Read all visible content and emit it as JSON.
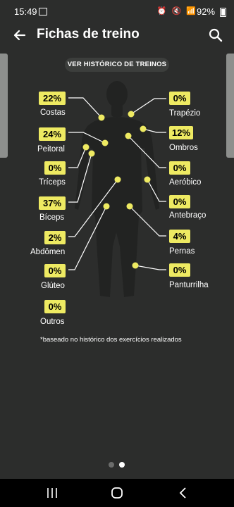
{
  "status": {
    "time": "15:49",
    "battery": "92%",
    "icons": "⏰ 🔇 📶"
  },
  "header": {
    "title": "Fichas de treino"
  },
  "history_button": "VER HISTÓRICO DE TREINOS",
  "muscles": {
    "costas": {
      "label": "Costas",
      "value": "22%"
    },
    "peitoral": {
      "label": "Peitoral",
      "value": "24%"
    },
    "triceps": {
      "label": "Tríceps",
      "value": "0%"
    },
    "biceps": {
      "label": "Bíceps",
      "value": "37%"
    },
    "abdomen": {
      "label": "Abdômen",
      "value": "2%"
    },
    "gluteo": {
      "label": "Glúteo",
      "value": "0%"
    },
    "outros": {
      "label": "Outros",
      "value": "0%"
    },
    "trapezio": {
      "label": "Trapézio",
      "value": "0%"
    },
    "ombros": {
      "label": "Ombros",
      "value": "12%"
    },
    "aerobico": {
      "label": "Aeróbico",
      "value": "0%"
    },
    "antebraco": {
      "label": "Antebraço",
      "value": "0%"
    },
    "pernas": {
      "label": "Pernas",
      "value": "4%"
    },
    "panturrilha": {
      "label": "Panturrilha",
      "value": "0%"
    }
  },
  "footnote": "*baseado no histórico dos exercícios realizados",
  "pager": {
    "pages": 2,
    "active": 2
  },
  "colors": {
    "accent": "#eeea62",
    "background": "#2c2d2c",
    "silhouette": "#222322"
  }
}
